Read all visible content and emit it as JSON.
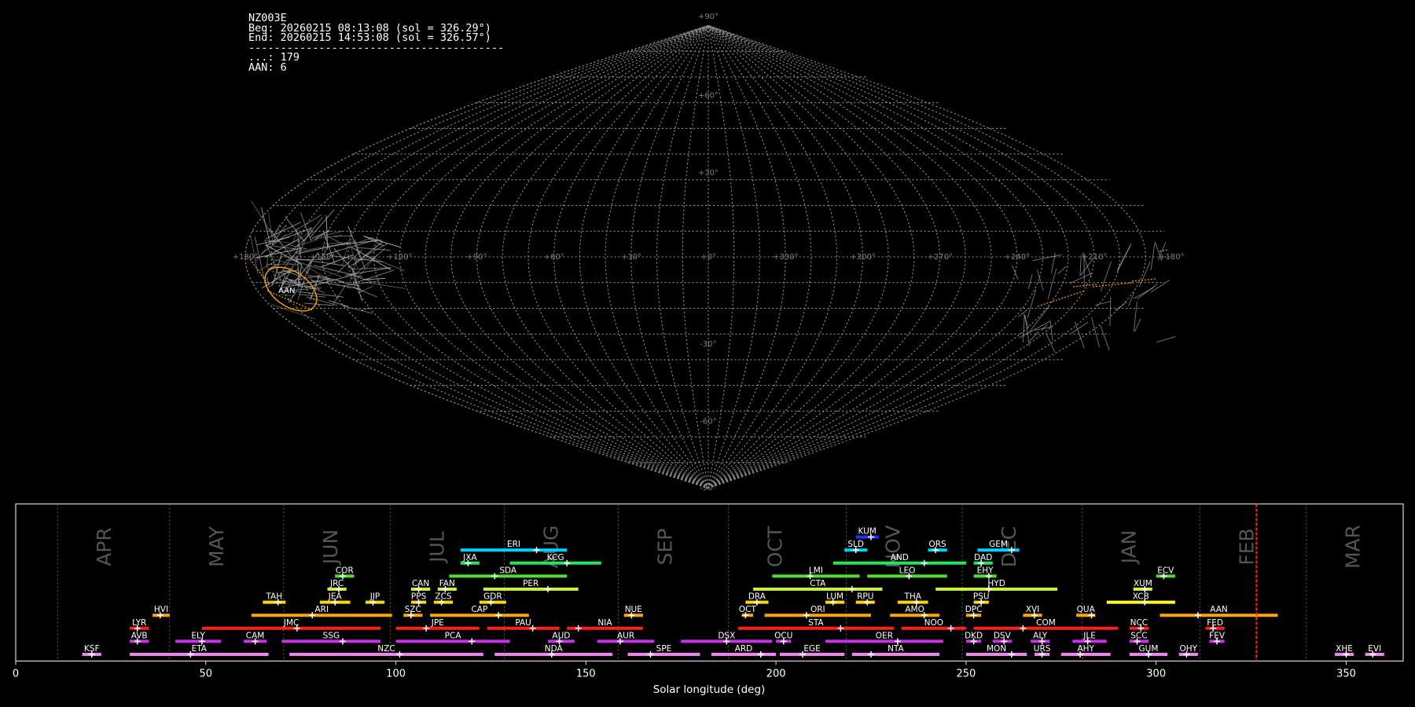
{
  "header": {
    "station": "NZ003E",
    "begin": "Beg: 20260215 08:13:08 (sol = 326.29°)",
    "end": "End: 20260215 14:53:08 (sol = 326.57°)",
    "separator": "----------------------------------------",
    "count_sporadic": "...: 179",
    "count_aan": "AAN: 6"
  },
  "sky_map": {
    "projection": "sinusoidal",
    "lat_labels": [
      "+90°",
      "+60°",
      "+30°",
      "-30°",
      "-60°",
      "-90°"
    ],
    "lon_labels": [
      "+180°",
      "+150°",
      "+120°",
      "+90°",
      "+60°",
      "+30°",
      "+0°",
      "+330°",
      "+300°",
      "+270°",
      "+240°",
      "+210°",
      "+180°"
    ],
    "radiant_label": "AAN",
    "colors": {
      "grid": "#8a8a8a",
      "meteor": "#b5b5b5",
      "shower": "#ffa500",
      "current": "#ff2020"
    }
  },
  "chart_data": {
    "type": "timeline",
    "xlabel": "Solar longitude (deg)",
    "xlim": [
      0,
      365
    ],
    "xticks": [
      0,
      50,
      100,
      150,
      200,
      250,
      300,
      350
    ],
    "current_sol": 326.4,
    "months": [
      {
        "label": "APR",
        "start": 11
      },
      {
        "label": "MAY",
        "start": 40.5
      },
      {
        "label": "JUN",
        "start": 70.5
      },
      {
        "label": "JUL",
        "start": 98.5
      },
      {
        "label": "AUG",
        "start": 128.5
      },
      {
        "label": "SEP",
        "start": 158.5
      },
      {
        "label": "OCT",
        "start": 187.5
      },
      {
        "label": "NOV",
        "start": 218.5
      },
      {
        "label": "DEC",
        "start": 249
      },
      {
        "label": "JAN",
        "start": 280.5
      },
      {
        "label": "FEB",
        "start": 311.5
      },
      {
        "label": "MAR",
        "start": 339.5
      }
    ],
    "showers": [
      {
        "code": "KSF",
        "start": 17.5,
        "end": 22.5,
        "peak": 20,
        "row": 0,
        "color": "#ee82ee"
      },
      {
        "code": "ETA",
        "start": 30,
        "end": 66.5,
        "peak": 46,
        "row": 0,
        "color": "#ee82ee"
      },
      {
        "code": "NZC",
        "start": 72,
        "end": 123,
        "peak": 101,
        "row": 0,
        "color": "#ee82ee"
      },
      {
        "code": "NDA",
        "start": 126,
        "end": 157,
        "peak": 141,
        "row": 0,
        "color": "#ee82ee"
      },
      {
        "code": "SPE",
        "start": 161,
        "end": 180,
        "peak": 167,
        "row": 0,
        "color": "#ee82ee"
      },
      {
        "code": "ARD",
        "start": 183,
        "end": 200,
        "peak": 196,
        "row": 0,
        "color": "#ee82ee"
      },
      {
        "code": "EGE",
        "start": 201,
        "end": 218,
        "peak": 207,
        "row": 0,
        "color": "#ee82ee"
      },
      {
        "code": "NTA",
        "start": 220,
        "end": 243,
        "peak": 225,
        "row": 0,
        "color": "#ee82ee"
      },
      {
        "code": "MON",
        "start": 250,
        "end": 266,
        "peak": 262,
        "row": 0,
        "color": "#ee82ee"
      },
      {
        "code": "URS",
        "start": 268,
        "end": 272,
        "peak": 270,
        "row": 0,
        "color": "#ee82ee"
      },
      {
        "code": "AHY",
        "start": 275,
        "end": 288,
        "peak": 280,
        "row": 0,
        "color": "#ee82ee"
      },
      {
        "code": "GUM",
        "start": 293,
        "end": 303,
        "peak": 298,
        "row": 0,
        "color": "#ee82ee"
      },
      {
        "code": "OHY",
        "start": 306,
        "end": 311,
        "peak": 308,
        "row": 0,
        "color": "#ee82ee"
      },
      {
        "code": "XHE",
        "start": 347,
        "end": 352,
        "peak": 350,
        "row": 0,
        "color": "#ee82ee"
      },
      {
        "code": "EVI",
        "start": 355,
        "end": 360,
        "peak": 357,
        "row": 0,
        "color": "#ee82ee"
      },
      {
        "code": "AVB",
        "start": 30,
        "end": 35,
        "peak": 32,
        "row": 1,
        "color": "#c832e6"
      },
      {
        "code": "ELY",
        "start": 42,
        "end": 54,
        "peak": 49,
        "row": 1,
        "color": "#c832e6"
      },
      {
        "code": "CAM",
        "start": 60,
        "end": 66,
        "peak": 63,
        "row": 1,
        "color": "#c832e6"
      },
      {
        "code": "SSG",
        "start": 70,
        "end": 96,
        "peak": 86,
        "row": 1,
        "color": "#c832e6"
      },
      {
        "code": "PCA",
        "start": 100,
        "end": 130,
        "peak": 120,
        "row": 1,
        "color": "#c832e6"
      },
      {
        "code": "AUD",
        "start": 140,
        "end": 147,
        "peak": 143,
        "row": 1,
        "color": "#c832e6"
      },
      {
        "code": "AUR",
        "start": 153,
        "end": 168,
        "peak": 159,
        "row": 1,
        "color": "#c832e6"
      },
      {
        "code": "DSX",
        "start": 175,
        "end": 199,
        "peak": 187,
        "row": 1,
        "color": "#c832e6"
      },
      {
        "code": "OCU",
        "start": 200,
        "end": 204,
        "peak": 202,
        "row": 1,
        "color": "#c832e6"
      },
      {
        "code": "OER",
        "start": 213,
        "end": 244,
        "peak": 232,
        "row": 1,
        "color": "#c832e6"
      },
      {
        "code": "DKD",
        "start": 250,
        "end": 254,
        "peak": 252,
        "row": 1,
        "color": "#c832e6"
      },
      {
        "code": "DSV",
        "start": 257,
        "end": 262,
        "peak": 260,
        "row": 1,
        "color": "#c832e6"
      },
      {
        "code": "ALY",
        "start": 267,
        "end": 272,
        "peak": 270,
        "row": 1,
        "color": "#c832e6"
      },
      {
        "code": "JLE",
        "start": 278,
        "end": 287,
        "peak": 282,
        "row": 1,
        "color": "#c832e6"
      },
      {
        "code": "SCC",
        "start": 293,
        "end": 298,
        "peak": 295,
        "row": 1,
        "color": "#c832e6"
      },
      {
        "code": "FEV",
        "start": 314,
        "end": 318,
        "peak": 316,
        "row": 1,
        "color": "#c832e6"
      },
      {
        "code": "LYR",
        "start": 30,
        "end": 35,
        "peak": 32,
        "row": 2,
        "color": "#ff1e1e"
      },
      {
        "code": "JMC",
        "start": 49,
        "end": 96,
        "peak": 74,
        "row": 2,
        "color": "#ff1e1e"
      },
      {
        "code": "JPE",
        "start": 100,
        "end": 122,
        "peak": 108,
        "row": 2,
        "color": "#ff1e1e"
      },
      {
        "code": "PAU",
        "start": 124,
        "end": 143,
        "peak": 136,
        "row": 2,
        "color": "#ff1e1e"
      },
      {
        "code": "NIA",
        "start": 145,
        "end": 165,
        "peak": 148,
        "row": 2,
        "color": "#ff1e1e"
      },
      {
        "code": "STA",
        "start": 190,
        "end": 231,
        "peak": 217,
        "row": 2,
        "color": "#ff1e1e"
      },
      {
        "code": "NOO",
        "start": 233,
        "end": 250,
        "peak": 246,
        "row": 2,
        "color": "#ff1e1e"
      },
      {
        "code": "COM",
        "start": 252,
        "end": 290,
        "peak": 265,
        "row": 2,
        "color": "#ff1e1e"
      },
      {
        "code": "NCC",
        "start": 293,
        "end": 298,
        "peak": 296,
        "row": 2,
        "color": "#ff1e1e"
      },
      {
        "code": "FED",
        "start": 313,
        "end": 318,
        "peak": 315,
        "row": 2,
        "color": "#ff1e1e"
      },
      {
        "code": "HVI",
        "start": 36,
        "end": 40.5,
        "peak": 38,
        "row": 3,
        "color": "#ffa500"
      },
      {
        "code": "ARI",
        "start": 62,
        "end": 99,
        "peak": 78,
        "row": 3,
        "color": "#ffa500"
      },
      {
        "code": "SZC",
        "start": 102,
        "end": 107,
        "peak": 104,
        "row": 3,
        "color": "#ffa500"
      },
      {
        "code": "CAP",
        "start": 109,
        "end": 135,
        "peak": 127,
        "row": 3,
        "color": "#ffa500"
      },
      {
        "code": "NUE",
        "start": 160,
        "end": 165,
        "peak": 162,
        "row": 3,
        "color": "#ffa500"
      },
      {
        "code": "OCT",
        "start": 191,
        "end": 194,
        "peak": 192,
        "row": 3,
        "color": "#ffa500"
      },
      {
        "code": "ORI",
        "start": 197,
        "end": 225,
        "peak": 208,
        "row": 3,
        "color": "#ffa500"
      },
      {
        "code": "AMO",
        "start": 230,
        "end": 243,
        "peak": 239,
        "row": 3,
        "color": "#ffa500"
      },
      {
        "code": "DPC",
        "start": 250,
        "end": 254,
        "peak": 252,
        "row": 3,
        "color": "#ffa500"
      },
      {
        "code": "XVI",
        "start": 265,
        "end": 270,
        "peak": 268,
        "row": 3,
        "color": "#ffa500"
      },
      {
        "code": "QUA",
        "start": 279,
        "end": 284,
        "peak": 283,
        "row": 3,
        "color": "#ffa500"
      },
      {
        "code": "AAN",
        "start": 301,
        "end": 332,
        "peak": 311,
        "row": 3,
        "color": "#ffa500"
      },
      {
        "code": "TAH",
        "start": 65,
        "end": 71,
        "peak": 69,
        "row": 4,
        "color": "#ffd700"
      },
      {
        "code": "JEA",
        "start": 80,
        "end": 88,
        "peak": 84,
        "row": 4,
        "color": "#ffd700"
      },
      {
        "code": "JIP",
        "start": 92,
        "end": 97,
        "peak": 94,
        "row": 4,
        "color": "#ffd700"
      },
      {
        "code": "PPS",
        "start": 104,
        "end": 108,
        "peak": 106,
        "row": 4,
        "color": "#ffd700"
      },
      {
        "code": "ZCS",
        "start": 110,
        "end": 115,
        "peak": 112,
        "row": 4,
        "color": "#ffd700"
      },
      {
        "code": "GDR",
        "start": 122,
        "end": 129,
        "peak": 125,
        "row": 4,
        "color": "#ffd700"
      },
      {
        "code": "DRA",
        "start": 192,
        "end": 198,
        "peak": 195,
        "row": 4,
        "color": "#ffd700"
      },
      {
        "code": "LUM",
        "start": 213,
        "end": 218,
        "peak": 215,
        "row": 4,
        "color": "#ffd700"
      },
      {
        "code": "RPU",
        "start": 221,
        "end": 226,
        "peak": 224,
        "row": 4,
        "color": "#ffd700"
      },
      {
        "code": "THA",
        "start": 232,
        "end": 240,
        "peak": 237,
        "row": 4,
        "color": "#ffd700"
      },
      {
        "code": "PSU",
        "start": 252,
        "end": 256,
        "peak": 254,
        "row": 4,
        "color": "#ffd700"
      },
      {
        "code": "XCB",
        "start": 287,
        "end": 305,
        "peak": 297,
        "row": 4,
        "color": "#ffff1e"
      },
      {
        "code": "JRC",
        "start": 82,
        "end": 87,
        "peak": 85,
        "row": 5,
        "color": "#c8f03c"
      },
      {
        "code": "CAN",
        "start": 104,
        "end": 109,
        "peak": 106,
        "row": 5,
        "color": "#c8f03c"
      },
      {
        "code": "FAN",
        "start": 111,
        "end": 116,
        "peak": 113,
        "row": 5,
        "color": "#c8f03c"
      },
      {
        "code": "PER",
        "start": 123,
        "end": 148,
        "peak": 140,
        "row": 5,
        "color": "#c8f03c"
      },
      {
        "code": "CTA",
        "start": 194,
        "end": 228,
        "peak": 220,
        "row": 5,
        "color": "#c8f03c"
      },
      {
        "code": "HYD",
        "start": 242,
        "end": 274,
        "peak": 256,
        "row": 5,
        "color": "#c8f03c"
      },
      {
        "code": "XUM",
        "start": 294,
        "end": 299,
        "peak": 297,
        "row": 5,
        "color": "#c8f03c"
      },
      {
        "code": "COR",
        "start": 84,
        "end": 89,
        "peak": 86,
        "row": 6,
        "color": "#50dc32"
      },
      {
        "code": "SDA",
        "start": 114,
        "end": 145,
        "peak": 126,
        "row": 6,
        "color": "#50dc32"
      },
      {
        "code": "LMI",
        "start": 199,
        "end": 222,
        "peak": 209,
        "row": 6,
        "color": "#50dc32"
      },
      {
        "code": "LEO",
        "start": 224,
        "end": 245,
        "peak": 235,
        "row": 6,
        "color": "#50dc32"
      },
      {
        "code": "EHY",
        "start": 252,
        "end": 258,
        "peak": 256,
        "row": 6,
        "color": "#50dc32"
      },
      {
        "code": "ECV",
        "start": 300,
        "end": 305,
        "peak": 302,
        "row": 6,
        "color": "#50dc32"
      },
      {
        "code": "JXA",
        "start": 117,
        "end": 122,
        "peak": 119,
        "row": 7,
        "color": "#1ee664"
      },
      {
        "code": "KCG",
        "start": 130,
        "end": 154,
        "peak": 145,
        "row": 7,
        "color": "#1ee664"
      },
      {
        "code": "AND",
        "start": 215,
        "end": 250,
        "peak": 239,
        "row": 7,
        "color": "#1ee664"
      },
      {
        "code": "DAD",
        "start": 252,
        "end": 257,
        "peak": 254,
        "row": 7,
        "color": "#1ee664"
      },
      {
        "code": "ERI",
        "start": 117,
        "end": 145,
        "peak": 137,
        "row": 8,
        "color": "#00d2ff"
      },
      {
        "code": "SLD",
        "start": 218,
        "end": 224,
        "peak": 221,
        "row": 8,
        "color": "#00d2ff"
      },
      {
        "code": "ORS",
        "start": 240,
        "end": 245,
        "peak": 242,
        "row": 8,
        "color": "#00d2ff"
      },
      {
        "code": "GEM",
        "start": 253,
        "end": 264,
        "peak": 262,
        "row": 8,
        "color": "#00d2ff"
      },
      {
        "code": "KUM",
        "start": 221,
        "end": 227,
        "peak": 225,
        "row": 9,
        "color": "#1e32ff"
      }
    ]
  }
}
